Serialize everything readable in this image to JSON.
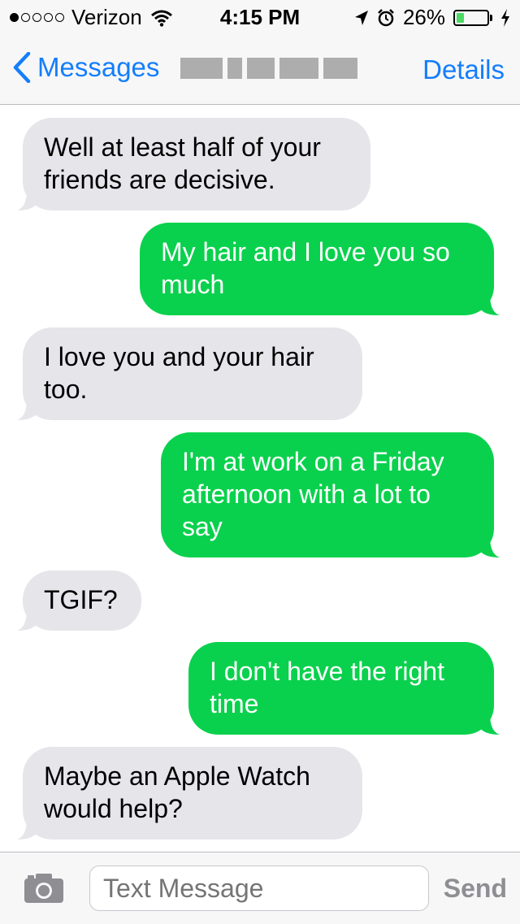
{
  "status_bar": {
    "signal_dots_filled": 1,
    "signal_dots_total": 5,
    "carrier": "Verizon",
    "time": "4:15 PM",
    "battery_percent": "26%",
    "battery_level": 0.26,
    "icons": [
      "wifi-icon",
      "location-arrow-icon",
      "alarm-icon",
      "battery-icon",
      "charging-bolt-icon"
    ]
  },
  "nav": {
    "back_label": "Messages",
    "details_label": "Details"
  },
  "messages": [
    {
      "direction": "incoming",
      "text": "Well at least half of your friends are decisive."
    },
    {
      "direction": "outgoing",
      "text": "My hair and I love you so much"
    },
    {
      "direction": "incoming",
      "text": "I love you and your hair too."
    },
    {
      "direction": "outgoing",
      "text": "I'm at work on a Friday afternoon with a lot to say"
    },
    {
      "direction": "incoming",
      "text": "TGIF?"
    },
    {
      "direction": "outgoing",
      "text": "I don't have the right time"
    },
    {
      "direction": "incoming",
      "text": "Maybe an Apple Watch would help?"
    }
  ],
  "composer": {
    "placeholder": "Text Message",
    "send_label": "Send",
    "camera_icon": "camera-icon"
  },
  "colors": {
    "incoming_bubble": "#e5e5ea",
    "outgoing_bubble": "#0ad14d",
    "accent": "#147efb"
  }
}
